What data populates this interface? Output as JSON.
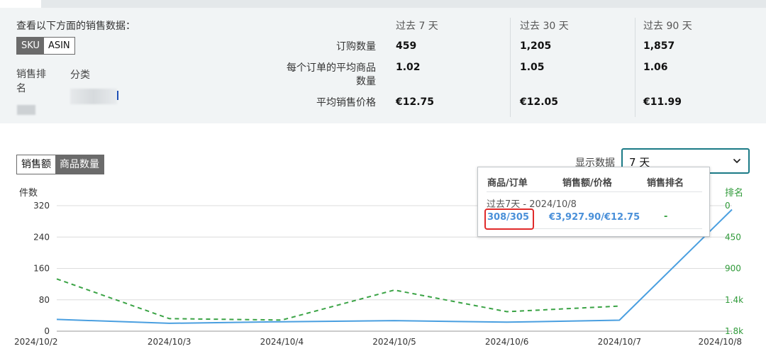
{
  "summary": {
    "intro": "查看以下方面的销售数据：",
    "id_toggle": {
      "sku": "SKU",
      "asin": "ASIN"
    },
    "rank_label": "销售排名",
    "category_label": "分类",
    "columns": [
      "过去 7 天",
      "过去 30 天",
      "过去 90 天"
    ],
    "rows": [
      {
        "label": "订购数量",
        "values": [
          "459",
          "1,205",
          "1,857"
        ]
      },
      {
        "label": "每个订单的平均商品数量",
        "values": [
          "1.02",
          "1.05",
          "1.06"
        ]
      },
      {
        "label": "平均销售价格",
        "values": [
          "€12.75",
          "€12.05",
          "€11.99"
        ]
      }
    ]
  },
  "controls": {
    "metric_toggle": {
      "sales": "销售额",
      "units": "商品数量"
    },
    "show_label": "显示数据",
    "period_select": "7 天"
  },
  "tooltip": {
    "headers": [
      "商品/订单",
      "销售额/价格",
      "销售排名"
    ],
    "period": "过去7天 - 2024/10/8",
    "units_orders": "308/305",
    "sales_price": "€3,927.90/€12.75",
    "rank": "-"
  },
  "chart_data": {
    "type": "line",
    "categories": [
      "2024/10/2",
      "2024/10/3",
      "2024/10/4",
      "2024/10/5",
      "2024/10/6",
      "2024/10/7",
      "2024/10/8"
    ],
    "yleft_label": "件数",
    "yright_label": "排名",
    "yleft_ticks": [
      "0",
      "80",
      "160",
      "240",
      "320"
    ],
    "yright_ticks": [
      "0",
      "450",
      "900",
      "1.4k",
      "1.8k"
    ],
    "yleft_range": [
      0,
      320
    ],
    "yright_range": [
      0,
      1800
    ],
    "yright_inverted": true,
    "grid": true,
    "series": [
      {
        "axis": "left",
        "color": "#4a9fe0",
        "style": "solid",
        "values": [
          30,
          20,
          24,
          27,
          23,
          28,
          310
        ]
      },
      {
        "axis": "right",
        "color": "#3aa345",
        "style": "dashed",
        "values": [
          1050,
          1620,
          1640,
          1210,
          1520,
          1440,
          null
        ]
      }
    ]
  }
}
